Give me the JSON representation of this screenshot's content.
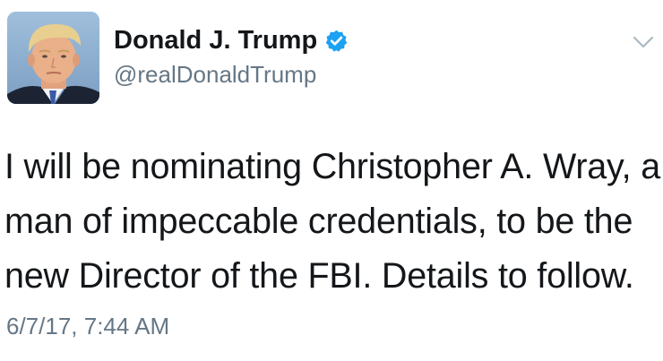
{
  "author": {
    "display_name": "Donald J. Trump",
    "handle": "@realDonaldTrump",
    "verified": true,
    "avatar_icon": "profile-photo",
    "verified_icon": "verified-badge-icon",
    "menu_icon": "chevron-down-icon"
  },
  "tweet": {
    "lines": [
      "I will be nominating Christopher A. Wray, a",
      "man of impeccable credentials, to be the",
      "new Director of the FBI. Details to follow."
    ],
    "timestamp": "6/7/17, 7:44 AM"
  },
  "colors": {
    "text": "#14171a",
    "secondary_text": "#657786",
    "verified_blue": "#1da1f2",
    "chevron": "#aab8c2"
  }
}
